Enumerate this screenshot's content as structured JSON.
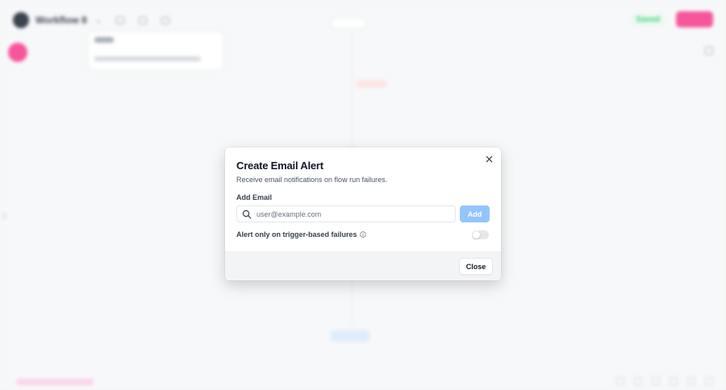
{
  "background": {
    "workspace_name": "Workflow 8",
    "status_badge": "Saved"
  },
  "modal": {
    "title": "Create Email Alert",
    "subtitle": "Receive email notifications on flow run failures.",
    "email_label": "Add Email",
    "email_placeholder": "user@example.com",
    "email_value": "",
    "add_label": "Add",
    "trigger_toggle_label": "Alert only on trigger-based failures",
    "trigger_toggle_on": false,
    "close_label": "Close"
  },
  "colors": {
    "accent": "#f43f8e",
    "add_button": "#93c5fd"
  },
  "icons": {
    "close": "close-icon",
    "search": "search-icon",
    "info": "info-icon"
  }
}
